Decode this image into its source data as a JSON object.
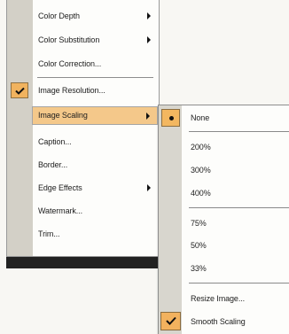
{
  "main_menu": {
    "items": [
      {
        "label": "Color Depth",
        "has_submenu": true
      },
      {
        "label": "Color Substitution",
        "has_submenu": true
      },
      {
        "label": "Color Correction...",
        "has_submenu": false
      },
      {
        "label": "Image Resolution...",
        "has_submenu": false,
        "checked": true
      },
      {
        "label": "Image Scaling",
        "has_submenu": true,
        "highlighted": true
      },
      {
        "label": "Caption...",
        "has_submenu": false
      },
      {
        "label": "Border...",
        "has_submenu": false
      },
      {
        "label": "Edge Effects",
        "has_submenu": true
      },
      {
        "label": "Watermark...",
        "has_submenu": false
      },
      {
        "label": "Trim...",
        "has_submenu": false
      }
    ]
  },
  "submenu": {
    "items": [
      {
        "label": "None",
        "selected": true
      },
      {
        "label": "200%"
      },
      {
        "label": "300%"
      },
      {
        "label": "400%"
      },
      {
        "label": "75%"
      },
      {
        "label": "50%"
      },
      {
        "label": "33%"
      },
      {
        "label": "Resize Image..."
      },
      {
        "label": "Smooth Scaling",
        "checked": true
      }
    ]
  },
  "colors": {
    "highlight": "#f4c88a",
    "check_background": "#f2b25e",
    "gutter": "#d7d4cb",
    "menu_background": "#fdfdfb"
  }
}
